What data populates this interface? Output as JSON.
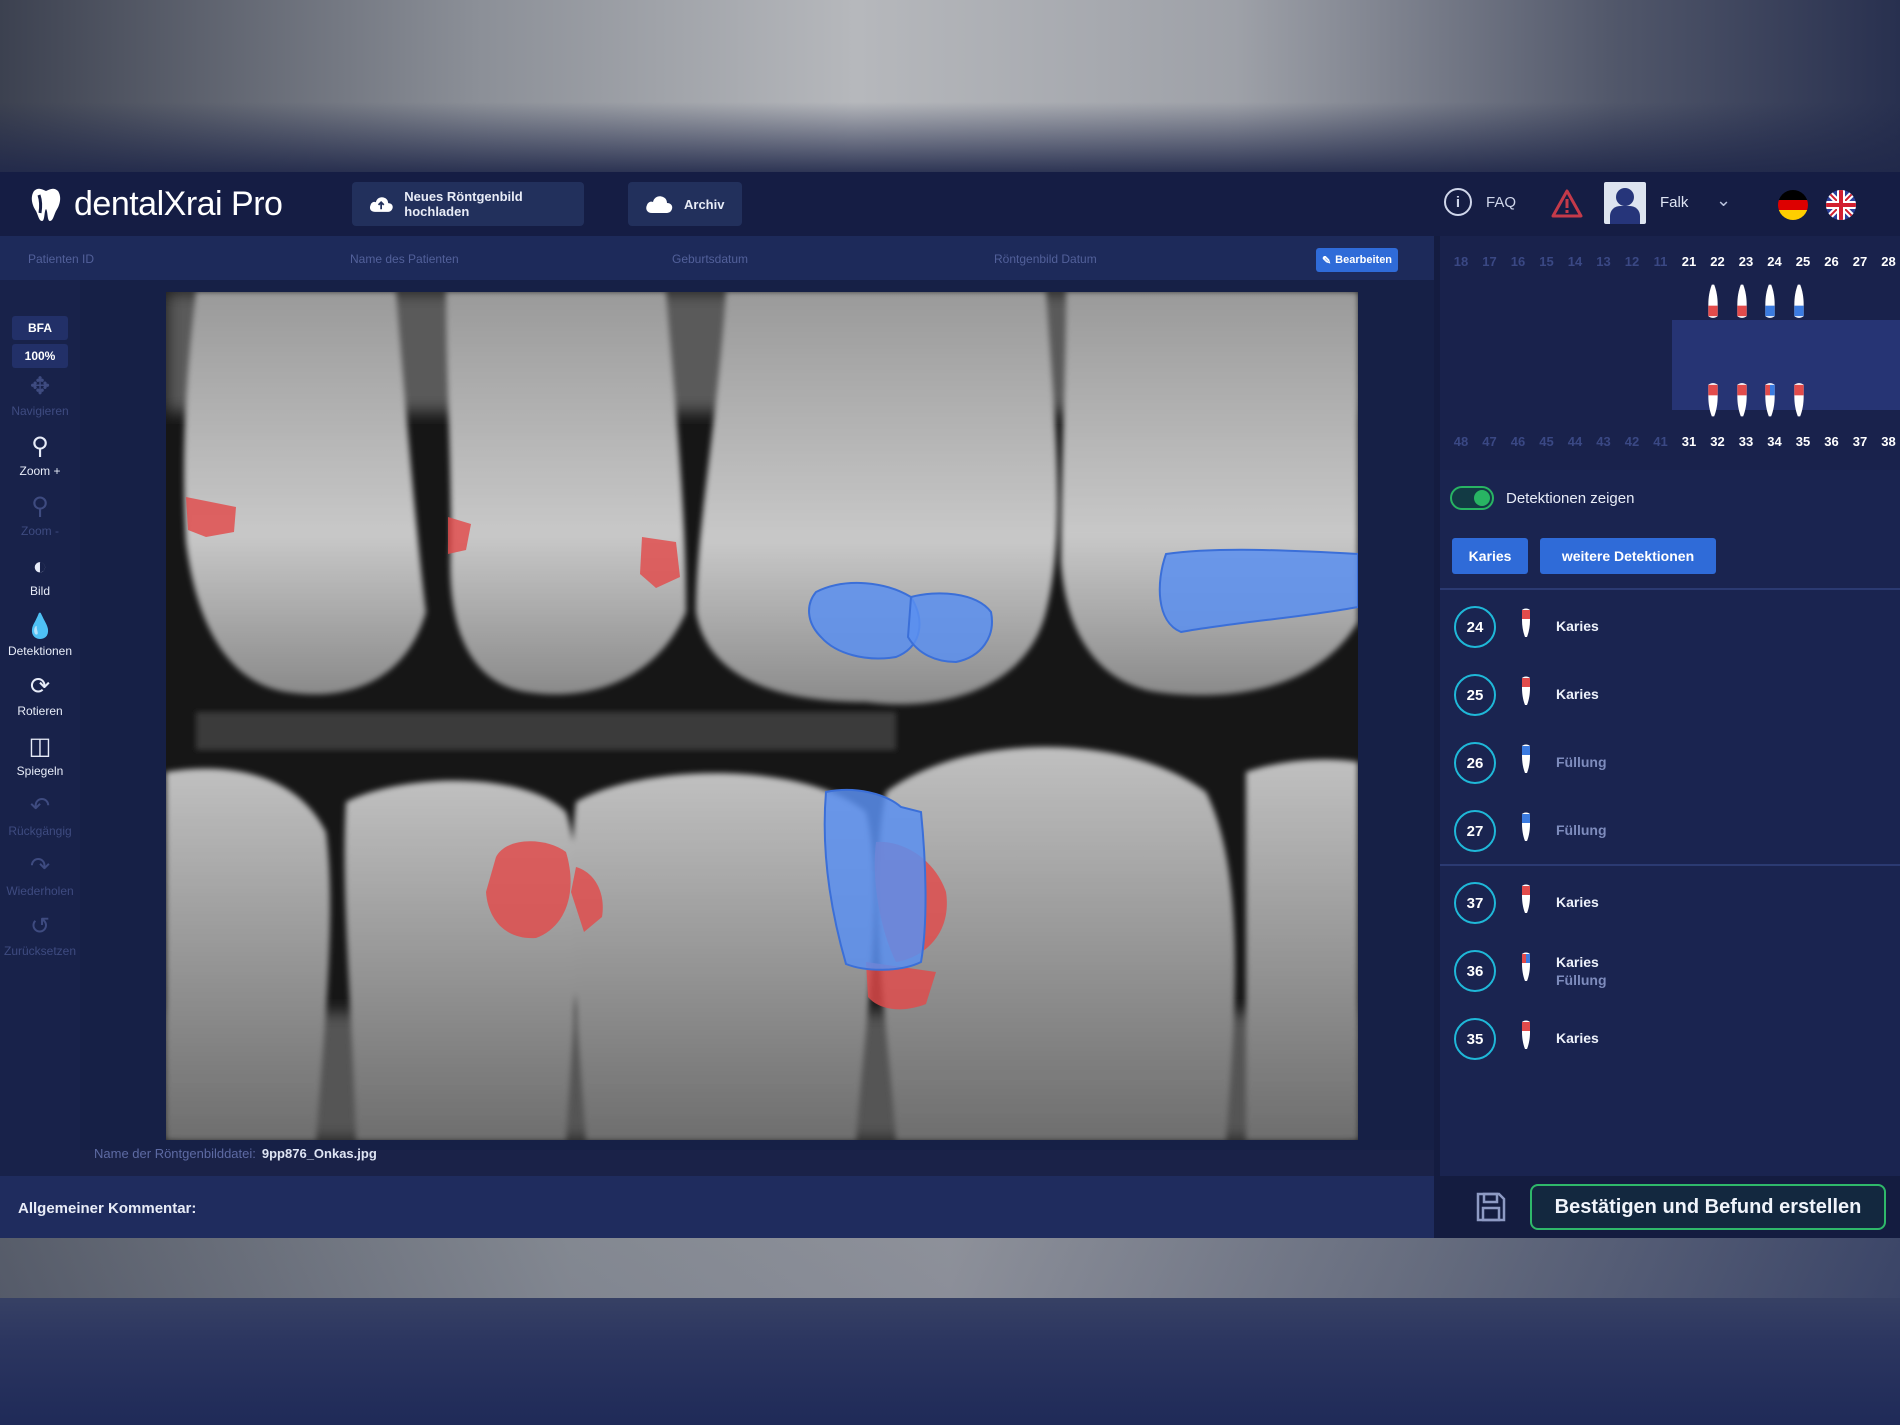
{
  "app": {
    "brand": "dentalXrai Pro"
  },
  "header": {
    "upload_label": "Neues Röntgenbild hochladen",
    "archive_label": "Archiv",
    "faq_label": "FAQ",
    "user_name": "Falk",
    "languages": [
      "DE",
      "EN"
    ]
  },
  "patient_bar": {
    "patient_id_label": "Patienten ID",
    "patient_name_label": "Name des Patienten",
    "birthdate_label": "Geburtsdatum",
    "xray_date_label": "Röntgenbild Datum",
    "edit_label": "Bearbeiten"
  },
  "toolbar": {
    "image_type": "BFA",
    "zoom_level": "100%",
    "tools": [
      {
        "label": "Navigieren",
        "icon": "move-icon",
        "enabled": false
      },
      {
        "label": "Zoom +",
        "icon": "zoom-in-icon",
        "enabled": true
      },
      {
        "label": "Zoom -",
        "icon": "zoom-out-icon",
        "enabled": false
      },
      {
        "label": "Bild",
        "icon": "brightness-icon",
        "enabled": true
      },
      {
        "label": "Detektionen",
        "icon": "opacity-drop-icon",
        "enabled": true
      },
      {
        "label": "Rotieren",
        "icon": "rotate-icon",
        "enabled": true
      },
      {
        "label": "Spiegeln",
        "icon": "mirror-icon",
        "enabled": true
      },
      {
        "label": "Rückgängig",
        "icon": "undo-icon",
        "enabled": false
      },
      {
        "label": "Wiederholen",
        "icon": "redo-icon",
        "enabled": false
      },
      {
        "label": "Zurücksetzen",
        "icon": "reset-icon",
        "enabled": false
      }
    ]
  },
  "viewer": {
    "filename_label": "Name der Röntgenbilddatei:",
    "filename": "9pp876_Onkas.jpg"
  },
  "comment": {
    "label": "Allgemeiner Kommentar:"
  },
  "dental_chart": {
    "upper_numbers": [
      "18",
      "17",
      "16",
      "15",
      "14",
      "13",
      "12",
      "11",
      "21",
      "22",
      "23",
      "24",
      "25",
      "26",
      "27",
      "28"
    ],
    "lower_numbers": [
      "48",
      "47",
      "46",
      "45",
      "44",
      "43",
      "42",
      "41",
      "31",
      "32",
      "33",
      "34",
      "35",
      "36",
      "37",
      "38"
    ],
    "active_upper": [
      "24",
      "25",
      "26",
      "27"
    ],
    "active_lower": [
      "34",
      "35",
      "36",
      "37"
    ]
  },
  "detections": {
    "toggle_label": "Detektionen zeigen",
    "toggle_on": true,
    "tab_caries": "Karies",
    "tab_more": "weitere Detektionen",
    "findings": [
      {
        "tooth": "24",
        "labels": [
          "Karies"
        ],
        "colors": [
          "#e24b4b"
        ]
      },
      {
        "tooth": "25",
        "labels": [
          "Karies"
        ],
        "colors": [
          "#e24b4b"
        ]
      },
      {
        "tooth": "26",
        "labels": [
          "Füllung"
        ],
        "colors": [
          "#3b7be0"
        ]
      },
      {
        "tooth": "27",
        "labels": [
          "Füllung"
        ],
        "colors": [
          "#3b7be0"
        ]
      },
      {
        "tooth": "37",
        "labels": [
          "Karies"
        ],
        "colors": [
          "#e24b4b"
        ]
      },
      {
        "tooth": "36",
        "labels": [
          "Karies",
          "Füllung"
        ],
        "colors": [
          "#e24b4b",
          "#3b7be0"
        ]
      },
      {
        "tooth": "35",
        "labels": [
          "Karies"
        ],
        "colors": [
          "#e24b4b"
        ]
      }
    ]
  },
  "footer": {
    "confirm_label": "Bestätigen und Befund erstellen"
  },
  "colors": {
    "caries": "#e24b4b",
    "filling": "#3b7be0",
    "accent": "#2f6bd8",
    "confirm_border": "#2fb86a"
  }
}
